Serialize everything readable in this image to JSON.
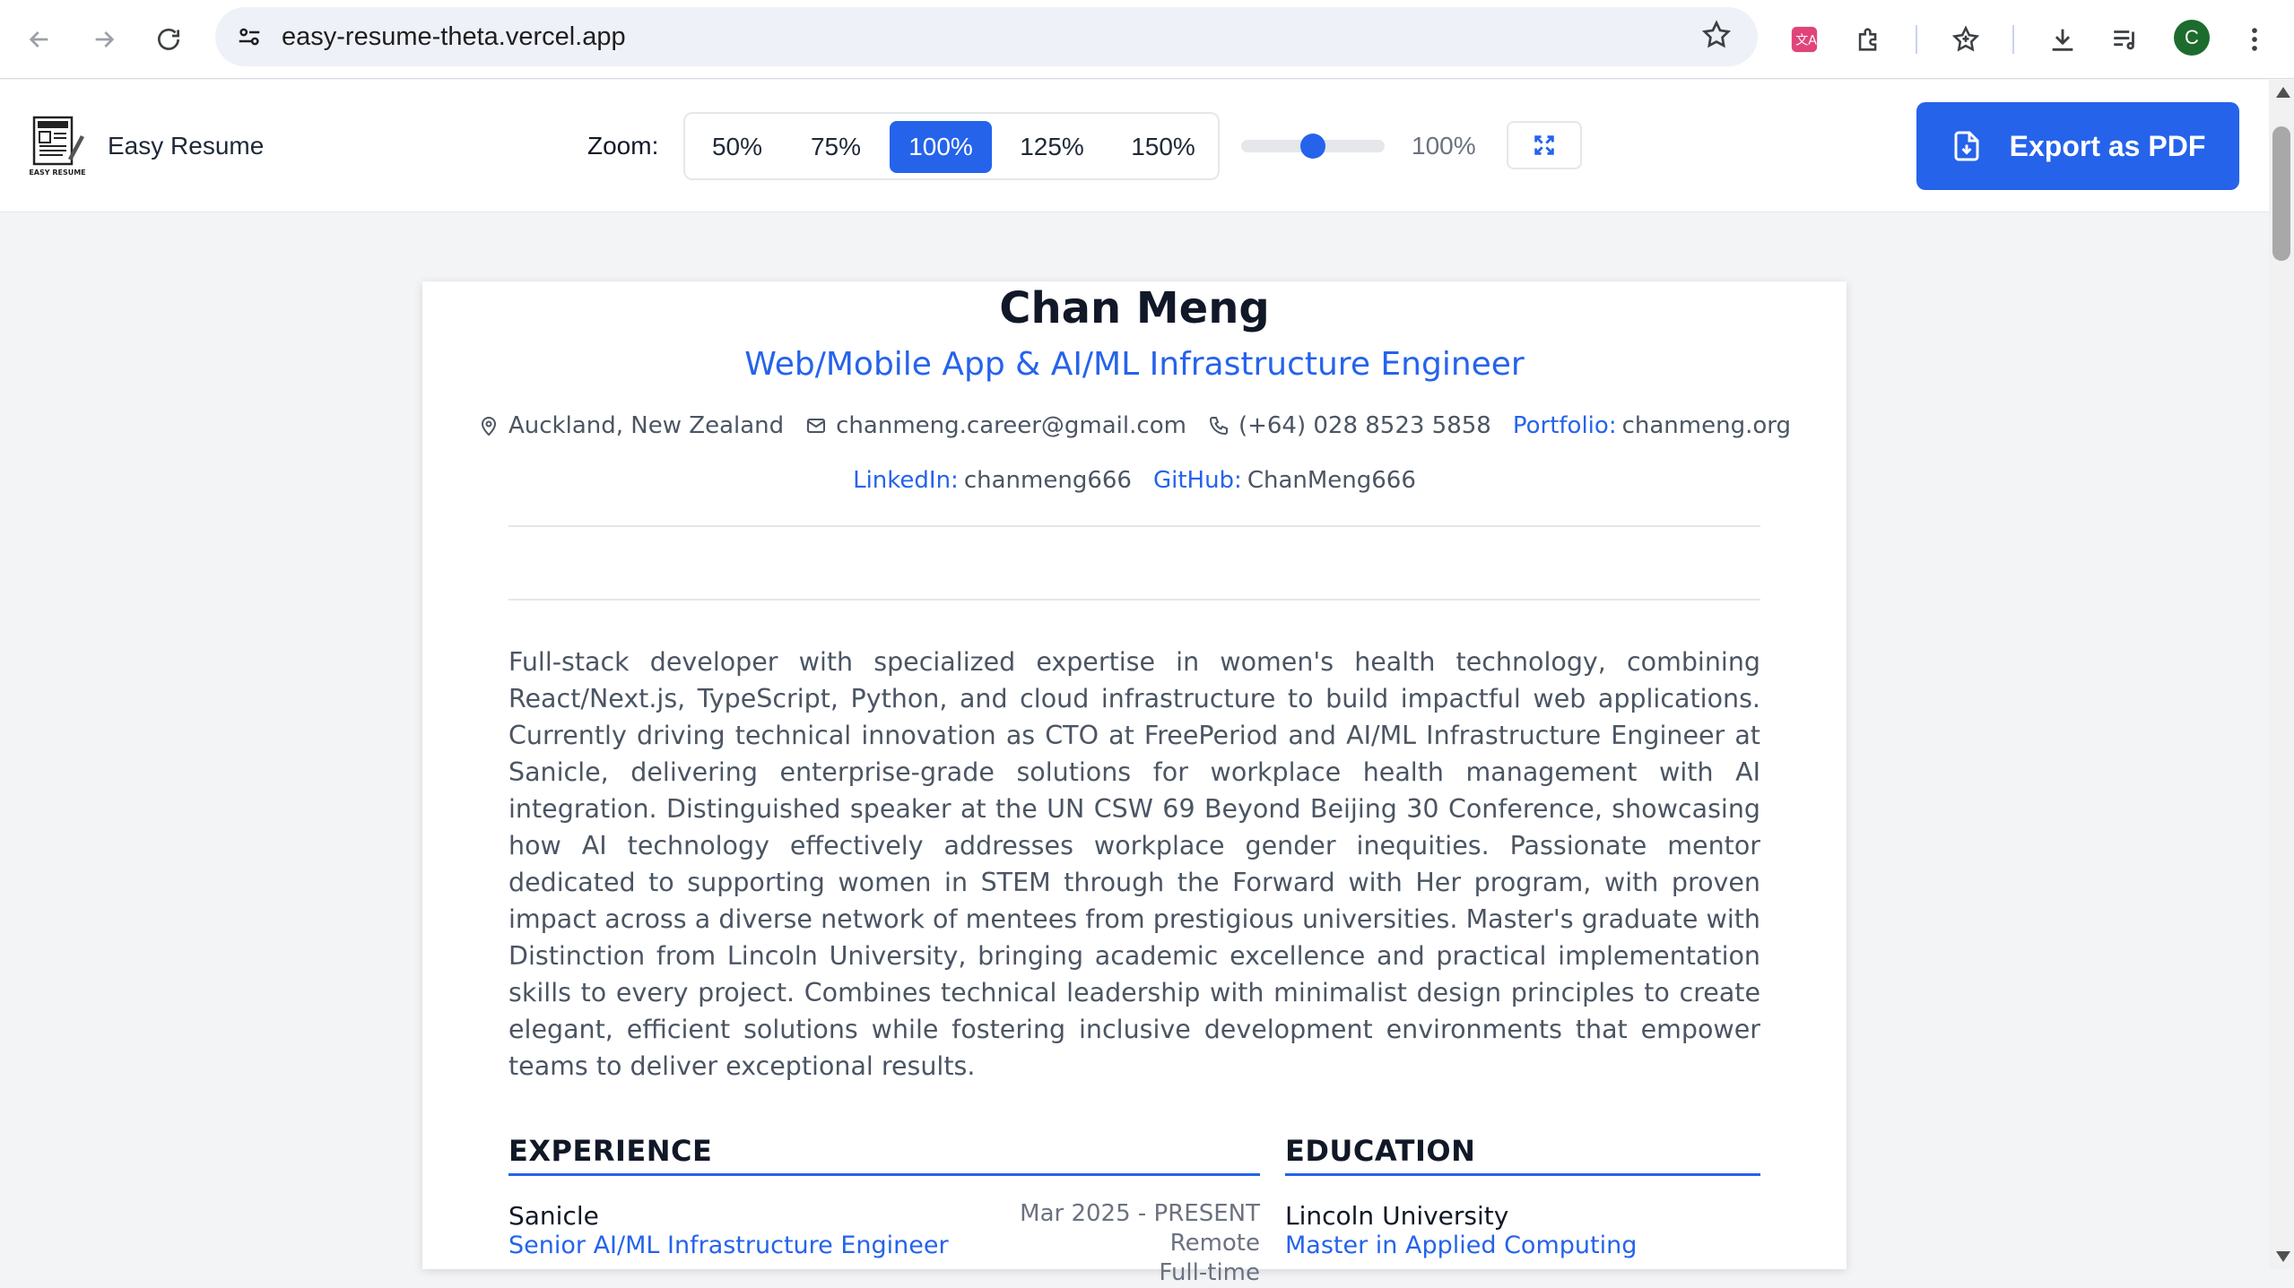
{
  "browser": {
    "url": "easy-resume-theta.vercel.app",
    "avatar_letter": "C"
  },
  "header": {
    "brand": "Easy Resume",
    "zoom_label": "Zoom:",
    "zoom_options": [
      "50%",
      "75%",
      "100%",
      "125%",
      "150%"
    ],
    "zoom_selected": "100%",
    "zoom_slider_value": "100%",
    "zoom_level_fraction": 0.5,
    "export_label": "Export as PDF",
    "accent_color": "#2563eb"
  },
  "resume": {
    "name": "Chan Meng",
    "title": "Web/Mobile App & AI/ML Infrastructure Engineer",
    "location": "Auckland, New Zealand",
    "email": "chanmeng.career@gmail.com",
    "phone": "(+64) 028 8523 5858",
    "portfolio_label": "Portfolio:",
    "portfolio": "chanmeng.org",
    "linkedin_label": "LinkedIn:",
    "linkedin": "chanmeng666",
    "github_label": "GitHub:",
    "github": "ChanMeng666",
    "summary": "Full-stack developer with specialized expertise in women's health technology, combining React/Next.js, TypeScript, Python, and cloud infrastructure to build impactful web applications. Currently driving technical innovation as CTO at FreePeriod and AI/ML Infrastructure Engineer at Sanicle, delivering enterprise-grade solutions for workplace health management with AI integration. Distinguished speaker at the UN CSW 69 Beyond Beijing 30 Conference, showcasing how AI technology effectively addresses workplace gender inequities. Passionate mentor dedicated to supporting women in STEM through the Forward with Her program, with proven impact across a diverse network of mentees from prestigious universities. Master's graduate with Distinction from Lincoln University, bringing academic excellence and practical implementation skills to every project. Combines technical leadership with minimalist design principles to create elegant, efficient solutions while fostering inclusive development environments that empower teams to deliver exceptional results.",
    "experience_heading": "EXPERIENCE",
    "education_heading": "EDUCATION",
    "experience": [
      {
        "org": "Sanicle",
        "role": "Senior AI/ML Infrastructure Engineer",
        "dates": "Mar 2025 - PRESENT",
        "location": "Remote",
        "type": "Full-time"
      }
    ],
    "education": [
      {
        "school": "Lincoln University",
        "degree": "Master in Applied Computing"
      }
    ]
  }
}
